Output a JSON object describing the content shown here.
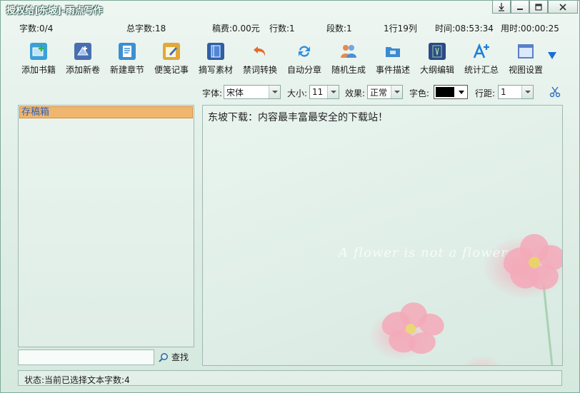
{
  "window": {
    "title": "授权给[东坡]-雨点写作",
    "controls": [
      "pin",
      "minimize",
      "maximize",
      "close"
    ]
  },
  "stats": {
    "chars": "字数:0/4",
    "total_chars": "总字数:18",
    "fee": "稿费:0.00元",
    "lines": "行数:1",
    "paragraphs": "段数:1",
    "position": "1行19列",
    "time": "时间:08:53:34",
    "elapsed": "用时:00:00:25"
  },
  "toolbar": {
    "items": [
      {
        "label": "添加书籍",
        "icon": "add-book-icon",
        "color": "#3aa0d8"
      },
      {
        "label": "添加新卷",
        "icon": "add-volume-icon",
        "color": "#4a6fb0"
      },
      {
        "label": "新建章节",
        "icon": "new-chapter-icon",
        "color": "#3d8fd1"
      },
      {
        "label": "便笺记事",
        "icon": "notepad-icon",
        "color": "#e0a93a"
      },
      {
        "label": "摘写素材",
        "icon": "material-book-icon",
        "color": "#2f5fa8"
      },
      {
        "label": "禁词转换",
        "icon": "undo-arrow-icon",
        "color": "#e56a2a"
      },
      {
        "label": "自动分章",
        "icon": "refresh-icon",
        "color": "#2f8fe0"
      },
      {
        "label": "随机生成",
        "icon": "users-icon",
        "color": "#4b8fd8"
      },
      {
        "label": "事件描述",
        "icon": "folder-icon",
        "color": "#3c8ad0"
      },
      {
        "label": "大纲编辑",
        "icon": "outline-book-icon",
        "color": "#2a4a88"
      },
      {
        "label": "统计汇总",
        "icon": "font-increase-icon",
        "color": "#1f7fd6"
      },
      {
        "label": "视图设置",
        "icon": "window-view-icon",
        "color": "#5a7fc8"
      }
    ],
    "more_icon": "chevron-down-icon"
  },
  "format": {
    "font_label": "字体:",
    "font_value": "宋体",
    "size_label": "大小:",
    "size_value": "11",
    "effect_label": "效果:",
    "effect_value": "正常",
    "color_label": "字色:",
    "color_value": "#000000",
    "spacing_label": "行距:",
    "spacing_value": "1",
    "tool_icon": "scissors-icon"
  },
  "tree": {
    "items": [
      {
        "label": "存稿箱"
      }
    ]
  },
  "search": {
    "value": "",
    "button_label": "查找"
  },
  "editor": {
    "content": "东坡下载：内容最丰富最安全的下载站！",
    "watermark": "A flower is not a flower..."
  },
  "status": {
    "text": "状态:当前已选择文本字数:4"
  }
}
